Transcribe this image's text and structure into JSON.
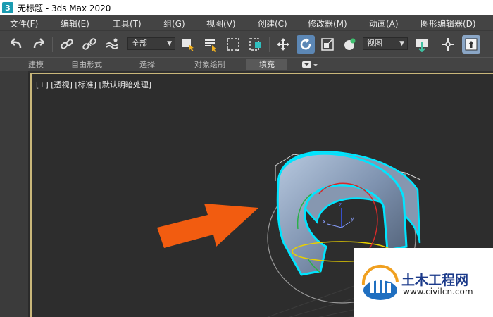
{
  "window": {
    "title": "无标题 - 3ds Max 2020",
    "app_icon_label": "3"
  },
  "menubar": {
    "items": [
      "文件(F)",
      "编辑(E)",
      "工具(T)",
      "组(G)",
      "视图(V)",
      "创建(C)",
      "修改器(M)",
      "动画(A)",
      "图形编辑器(D)"
    ]
  },
  "toolbar": {
    "selection_filter": "全部",
    "reference_coord": "视图"
  },
  "ribbon": {
    "tabs": [
      "建模",
      "自由形式",
      "选择",
      "对象绘制",
      "填充"
    ],
    "selected": "填充"
  },
  "viewport": {
    "label": "[+] [透视] [标准] [默认明暗处理]"
  },
  "watermark": {
    "title": "土木工程网",
    "url": "www.civilcn.com"
  },
  "colors": {
    "selection_outline": "#00e5ff",
    "arrow": "#f25c10",
    "active_button": "#5c87b5",
    "viewport_border": "#c9b77a"
  }
}
